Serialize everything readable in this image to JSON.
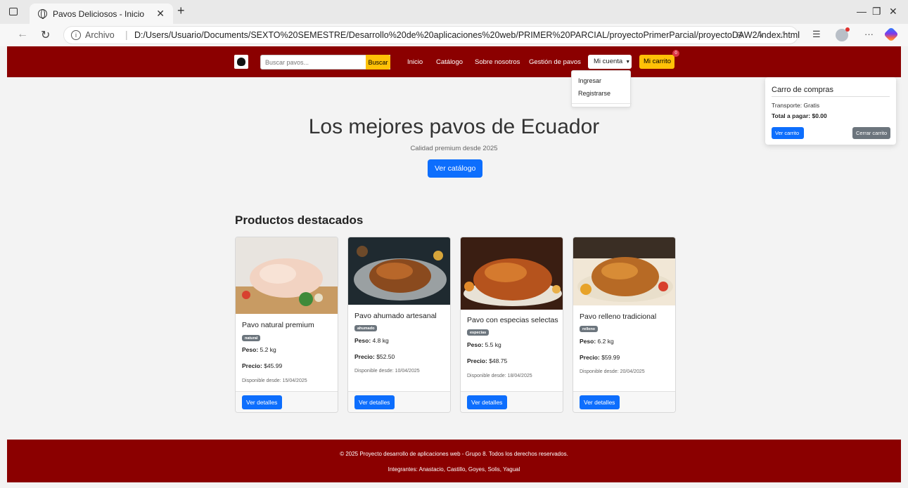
{
  "browser": {
    "tab_title": "Pavos Deliciosos - Inicio",
    "url_scheme_label": "Archivo",
    "url_path": "D:/Users/Usuario/Documents/SEXTO%20SEMESTRE/Desarrollo%20de%20aplicaciones%20web/PRIMER%20PARCIAL/proyectoPrimerParcial/proyectoDAW2/index.html"
  },
  "navbar": {
    "search_placeholder": "Buscar pavos...",
    "search_button": "Buscar",
    "links": [
      "Inicio",
      "Catálogo",
      "Sobre nosotros",
      "Gestión de pavos"
    ],
    "account_label": "Mi cuenta",
    "cart_label": "Mi carrito",
    "cart_count": "0",
    "brand_color": "#8b0000"
  },
  "account_menu": {
    "items": [
      "Ingresar",
      "Registrarse"
    ]
  },
  "cart_panel": {
    "title": "Carro de compras",
    "shipping": "Transporte: Gratis",
    "total_label": "Total a pagar:",
    "total_value": "$0.00",
    "view_button": "Ver carrito",
    "close_button": "Cerrar carrito"
  },
  "hero": {
    "title": "Los mejores pavos de Ecuador",
    "subtitle": "Calidad premium desde 2025",
    "button": "Ver catálogo"
  },
  "featured": {
    "title": "Productos destacados",
    "products": [
      {
        "name": "Pavo natural premium",
        "badge": "natural",
        "weight_label": "Peso:",
        "weight": "5.2 kg",
        "price_label": "Precio:",
        "price": "$45.99",
        "available": "Disponible desde: 15/04/2025",
        "button": "Ver detalles"
      },
      {
        "name": "Pavo ahumado artesanal",
        "badge": "ahumado",
        "weight_label": "Peso:",
        "weight": "4.8 kg",
        "price_label": "Precio:",
        "price": "$52.50",
        "available": "Disponible desde: 10/04/2025",
        "button": "Ver detalles"
      },
      {
        "name": "Pavo con especias selectas",
        "badge": "especias",
        "weight_label": "Peso:",
        "weight": "5.5 kg",
        "price_label": "Precio:",
        "price": "$48.75",
        "available": "Disponible desde: 18/04/2025",
        "button": "Ver detalles"
      },
      {
        "name": "Pavo relleno tradicional",
        "badge": "relleno",
        "weight_label": "Peso:",
        "weight": "6.2 kg",
        "price_label": "Precio:",
        "price": "$59.99",
        "available": "Disponible desde: 20/04/2025",
        "button": "Ver detalles"
      }
    ]
  },
  "footer": {
    "copyright": "© 2025 Proyecto desarrollo de aplicaciones web - Grupo 8. Todos los derechos reservados.",
    "members": "Integrantes: Anastacio, Castillo, Goyes, Solis, Yagual"
  }
}
